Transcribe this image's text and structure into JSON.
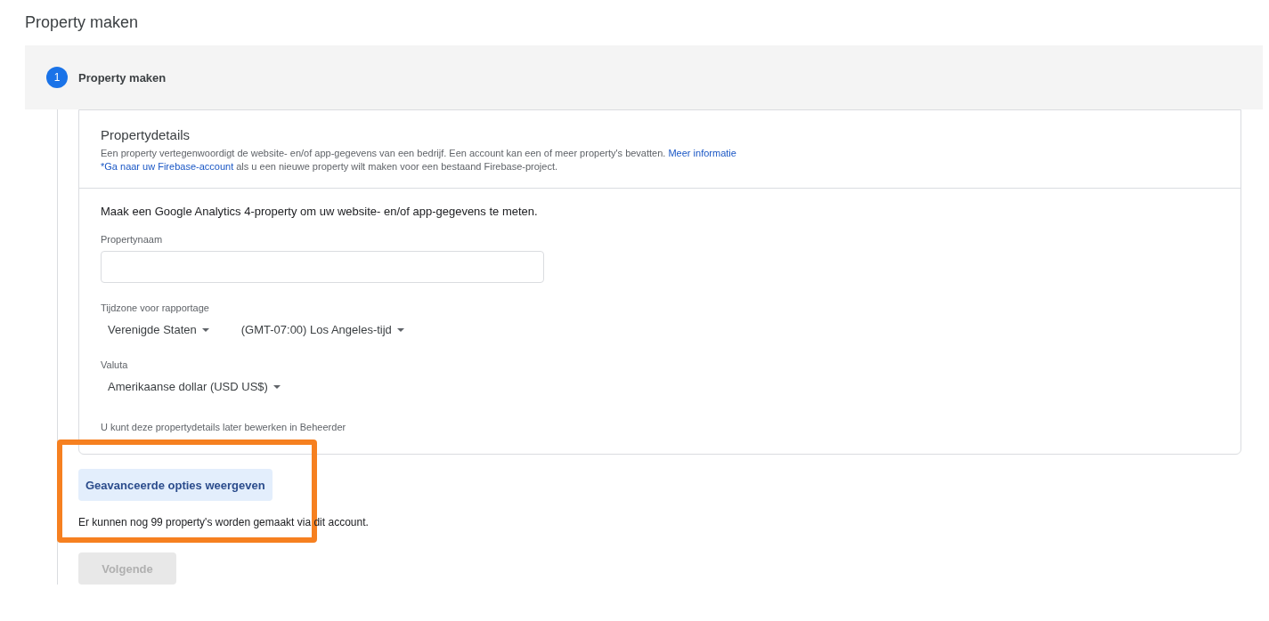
{
  "page_title": "Property maken",
  "step": {
    "number": "1",
    "label": "Property maken",
    "active": true
  },
  "details": {
    "title": "Propertydetails",
    "description": "Een property vertegenwoordigt de website- en/of app-gegevens van een bedrijf. Een account kan een of meer property's bevatten.",
    "more_link": "Meer informatie",
    "firebase_link": "*Ga naar uw Firebase-account",
    "firebase_text": "als u een nieuwe property wilt maken voor een bestaand Firebase-project."
  },
  "form": {
    "intro": "Maak een Google Analytics 4-property om uw website- en/of app-gegevens te meten.",
    "name_label": "Propertynaam",
    "timezone_label": "Tijdzone voor rapportage",
    "country": "Verenigde Staten",
    "timezone": "(GMT-07:00) Los Angeles-tijd",
    "currency_label": "Valuta",
    "currency": "Amerikaanse dollar (USD US$)",
    "note": "U kunt deze propertydetails later bewerken in Beheerder"
  },
  "advanced_button": {
    "label": "Geavanceerde opties weergeven",
    "highlighted": true
  },
  "remaining_text": "Er kunnen nog 99 property's worden gemaakt via dit account.",
  "next_button": {
    "label": "Volgende",
    "disabled": true
  }
}
